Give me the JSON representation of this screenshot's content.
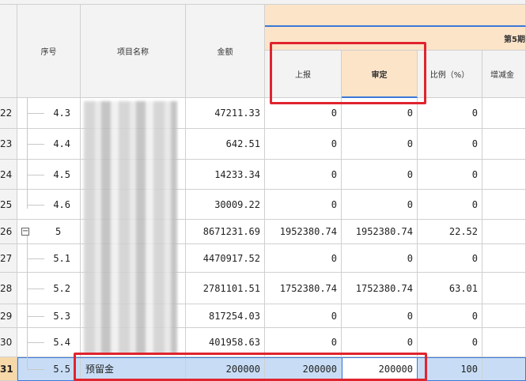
{
  "header": {
    "seq_label": "序号",
    "name_label": "项目名称",
    "amount_label": "金额",
    "group_label": "第5期",
    "reported_label": "上报",
    "approved_label": "审定",
    "ratio_label": "比例（%）",
    "delta_label": "增减金"
  },
  "rows": [
    {
      "row_no": "22",
      "seq": "4.3",
      "name": "",
      "amount": "47211.33",
      "reported": "0",
      "approved": "0",
      "ratio": "0"
    },
    {
      "row_no": "23",
      "seq": "4.4",
      "name": "",
      "amount": "642.51",
      "reported": "0",
      "approved": "0",
      "ratio": "0"
    },
    {
      "row_no": "24",
      "seq": "4.5",
      "name": "",
      "amount": "14233.34",
      "reported": "0",
      "approved": "0",
      "ratio": "0"
    },
    {
      "row_no": "25",
      "seq": "4.6",
      "name": "",
      "amount": "30009.22",
      "reported": "0",
      "approved": "0",
      "ratio": "0"
    },
    {
      "row_no": "26",
      "seq": "5",
      "name": "",
      "amount": "8671231.69",
      "reported": "1952380.74",
      "approved": "1952380.74",
      "ratio": "22.52"
    },
    {
      "row_no": "27",
      "seq": "5.1",
      "name": "",
      "amount": "4470917.52",
      "reported": "0",
      "approved": "0",
      "ratio": "0"
    },
    {
      "row_no": "28",
      "seq": "5.2",
      "name": "",
      "amount": "2781101.51",
      "reported": "1752380.74",
      "approved": "1752380.74",
      "ratio": "63.01"
    },
    {
      "row_no": "29",
      "seq": "5.3",
      "name": "",
      "amount": "817254.03",
      "reported": "0",
      "approved": "0",
      "ratio": "0"
    },
    {
      "row_no": "30",
      "seq": "5.4",
      "name": "",
      "amount": "401958.63",
      "reported": "0",
      "approved": "0",
      "ratio": "0"
    },
    {
      "row_no": "31",
      "seq": "5.5",
      "name": "预留金",
      "amount": "200000",
      "reported": "200000",
      "approved": "200000",
      "ratio": "100"
    }
  ],
  "tree_toggle": "−",
  "colors": {
    "highlight": "#e0242e",
    "selection": "#c8ddf5",
    "header_peach": "#fce4c8",
    "accent_blue": "#3b78d8"
  }
}
